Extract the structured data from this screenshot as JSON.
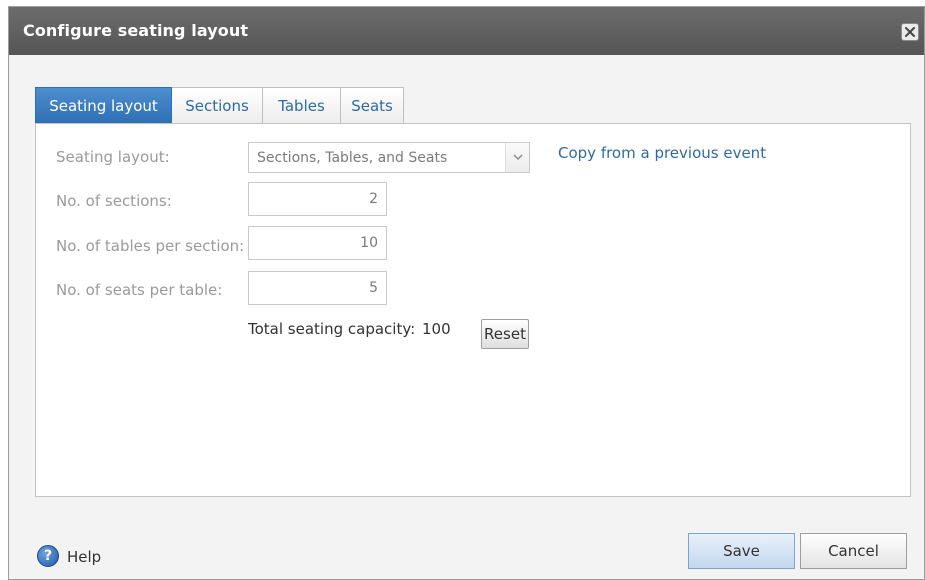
{
  "dialog": {
    "title": "Configure seating layout",
    "close_icon": "close-icon"
  },
  "tabs": [
    {
      "label": "Seating layout",
      "active": true
    },
    {
      "label": "Sections",
      "active": false
    },
    {
      "label": "Tables",
      "active": false
    },
    {
      "label": "Seats",
      "active": false
    }
  ],
  "form": {
    "layout_label": "Seating layout:",
    "layout_value": "Sections, Tables, and Seats",
    "copy_link": "Copy from a previous event",
    "sections_label": "No. of sections:",
    "sections_value": "2",
    "tables_label": "No. of tables per section:",
    "tables_value": "10",
    "seats_label": "No. of seats per table:",
    "seats_value": "5",
    "capacity_label": "Total seating capacity:",
    "capacity_value": "100",
    "reset_label": "Reset"
  },
  "footer": {
    "help_icon": "help-icon",
    "help_label": "Help",
    "save_label": "Save",
    "cancel_label": "Cancel"
  },
  "colors": {
    "titlebar": "#5e5e5e",
    "active_tab": "#3a7bc0",
    "link": "#2c6aa8"
  }
}
